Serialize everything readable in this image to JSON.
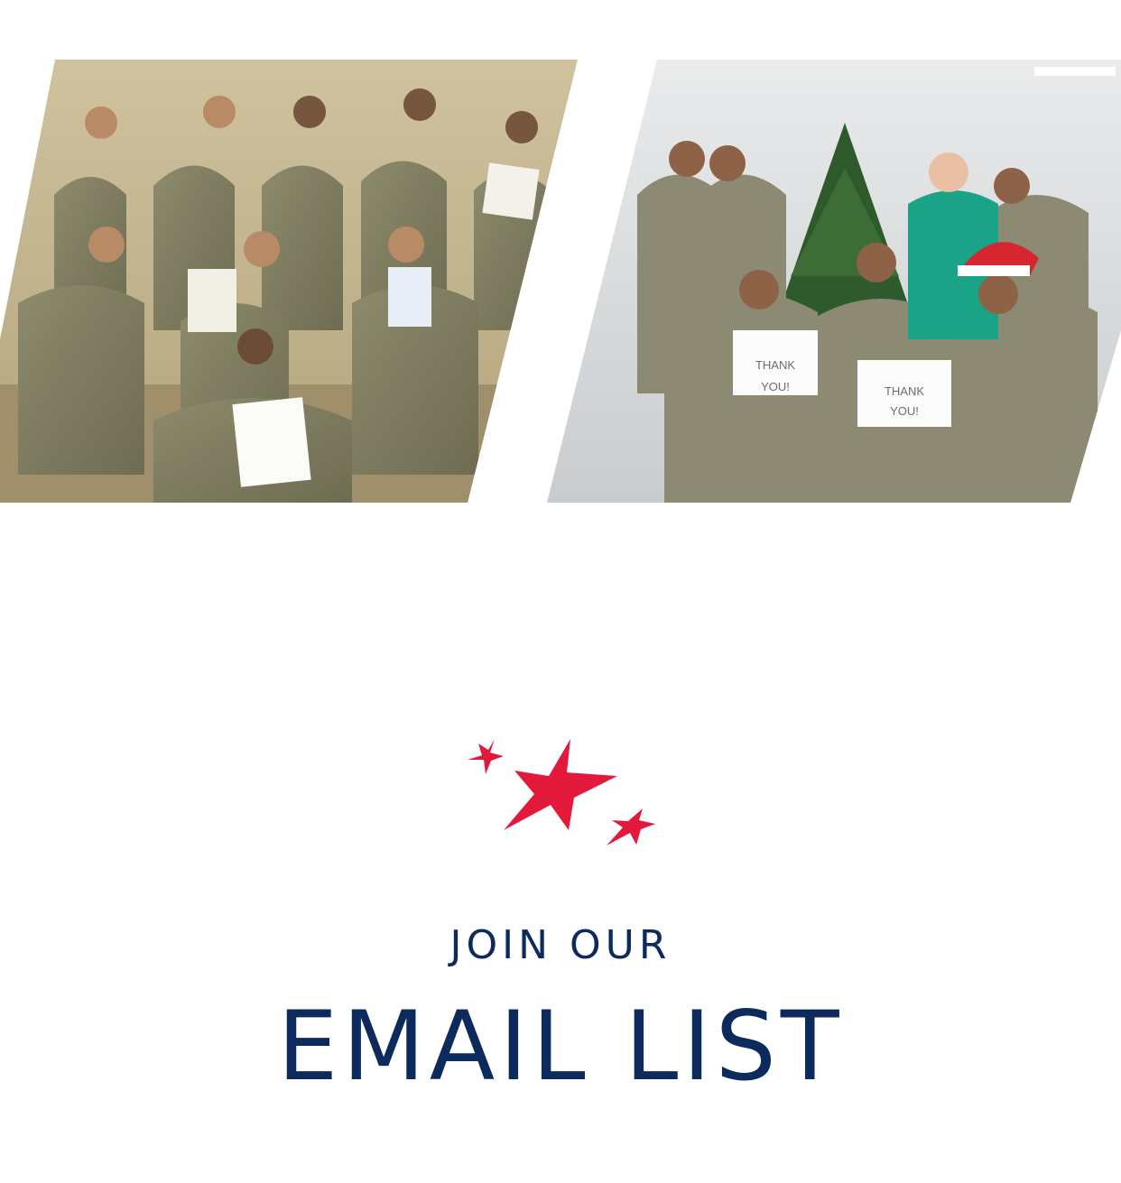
{
  "photos": {
    "left": {
      "icon": "group-photo-soldiers-with-letters"
    },
    "right": {
      "icon": "group-photo-soldiers-christmas-tree",
      "sign_one": [
        "THANK",
        "YOU!"
      ],
      "sign_two": [
        "THANK",
        "YOU!"
      ]
    }
  },
  "decoration": {
    "icon": "three-red-stars",
    "color": "#e3193b"
  },
  "signup": {
    "kicker": "JOIN OUR",
    "title": "EMAIL LIST",
    "color": "#0c2a5b"
  }
}
